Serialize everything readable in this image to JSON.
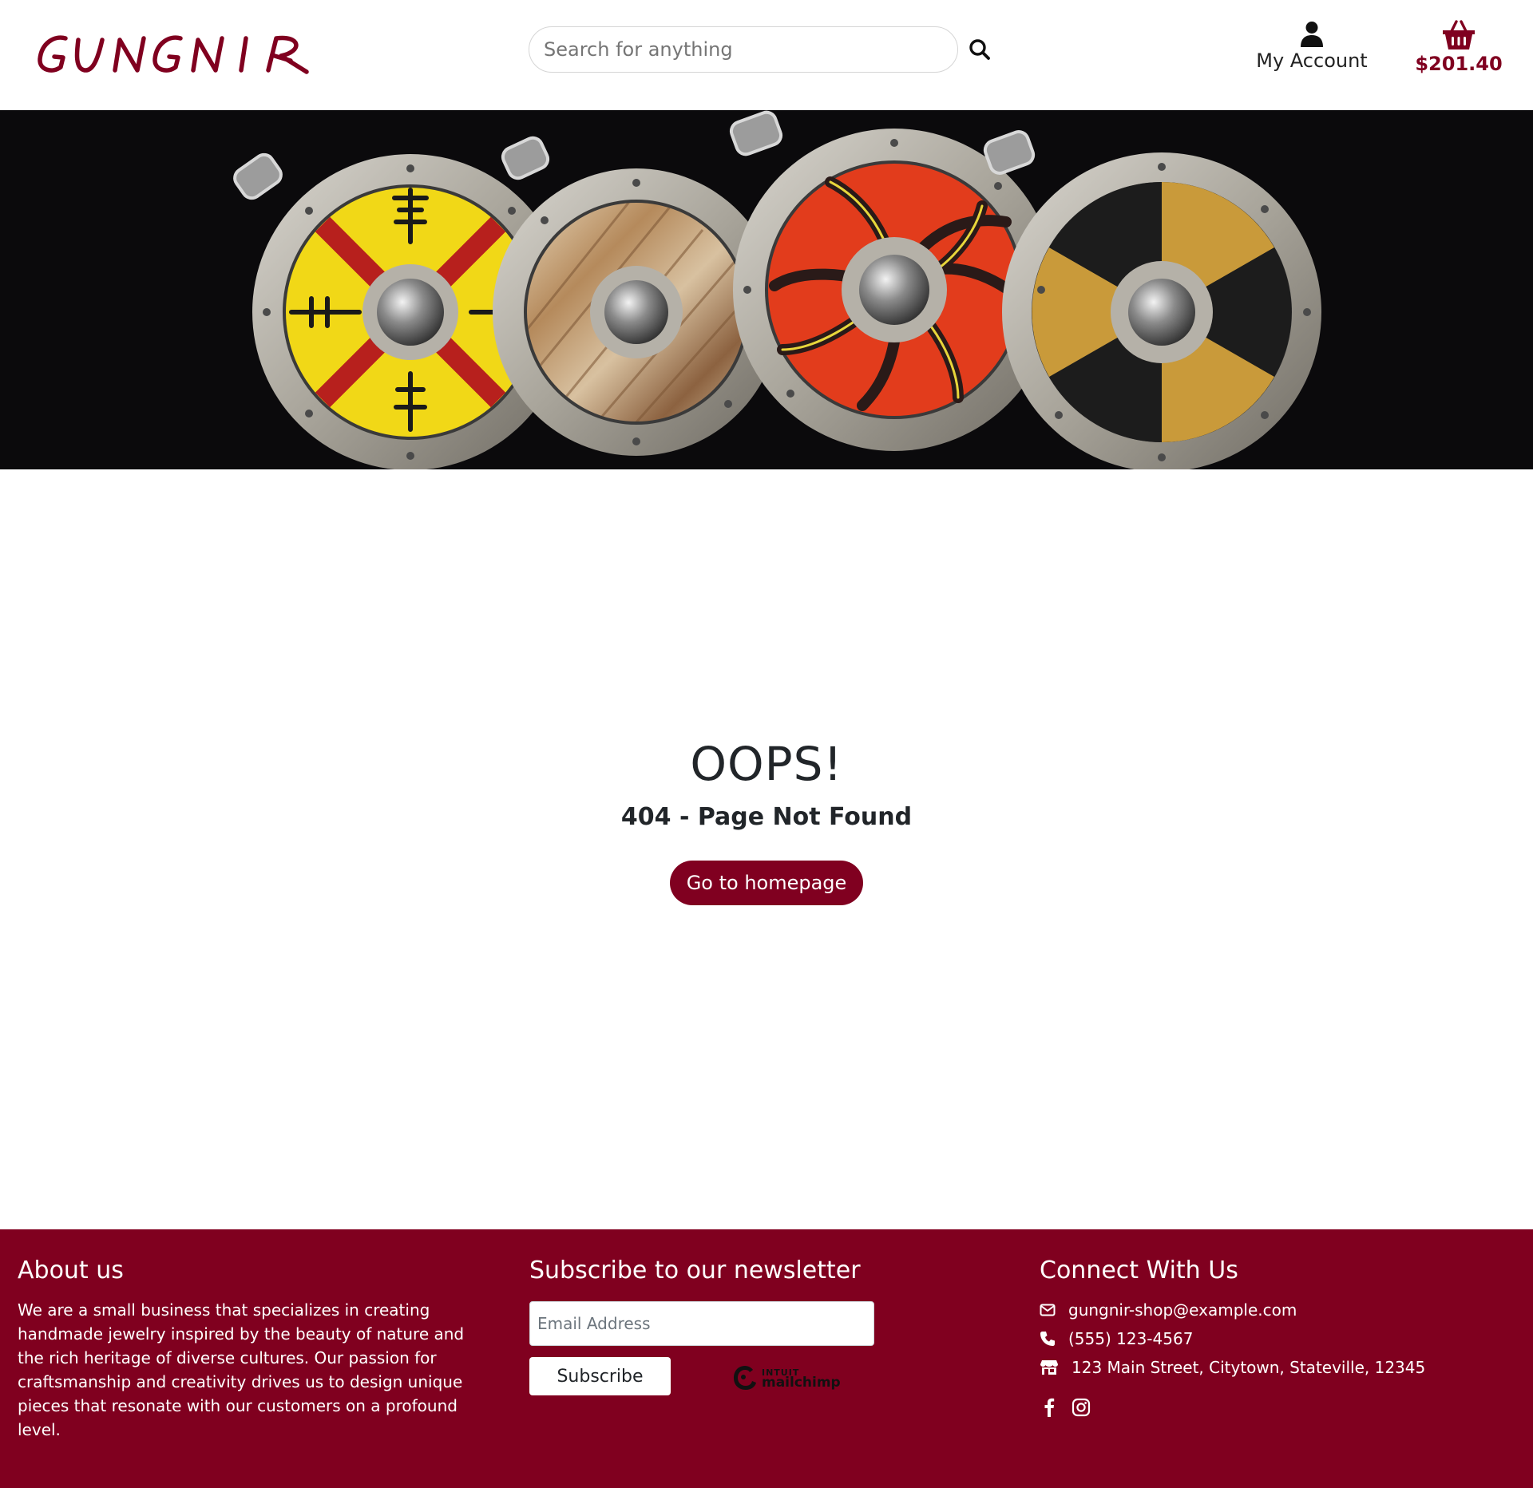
{
  "header": {
    "logo_text": "GUNGNIR",
    "search": {
      "placeholder": "Search for anything",
      "value": ""
    },
    "account_label": "My Account",
    "cart_total": "$201.40"
  },
  "hero": {
    "image": "four viking shield pendants"
  },
  "main": {
    "title": "OOPS!",
    "subtitle": "404 - Page Not Found",
    "button_label": "Go to homepage"
  },
  "footer": {
    "about": {
      "title": "About us",
      "text": "We are a small business that specializes in creating handmade jewelry inspired by the beauty of nature and the rich heritage of diverse cultures. Our passion for craftsmanship and creativity drives us to design unique pieces that resonate with our customers on a profound level."
    },
    "newsletter": {
      "title": "Subscribe to our newsletter",
      "email_placeholder": "Email Address",
      "button_label": "Subscribe",
      "mailchimp_top": "INTUIT",
      "mailchimp_bottom": "mailchimp"
    },
    "connect": {
      "title": "Connect With Us",
      "email": "gungnir-shop@example.com",
      "phone": "(555) 123-4567",
      "address": "123 Main Street, Citytown, Stateville, 12345",
      "socials": [
        "facebook-icon",
        "instagram-icon"
      ]
    }
  },
  "colors": {
    "brand": "#800020",
    "footer_bg": "#80001f",
    "hero_bg": "#0b0a0c"
  }
}
